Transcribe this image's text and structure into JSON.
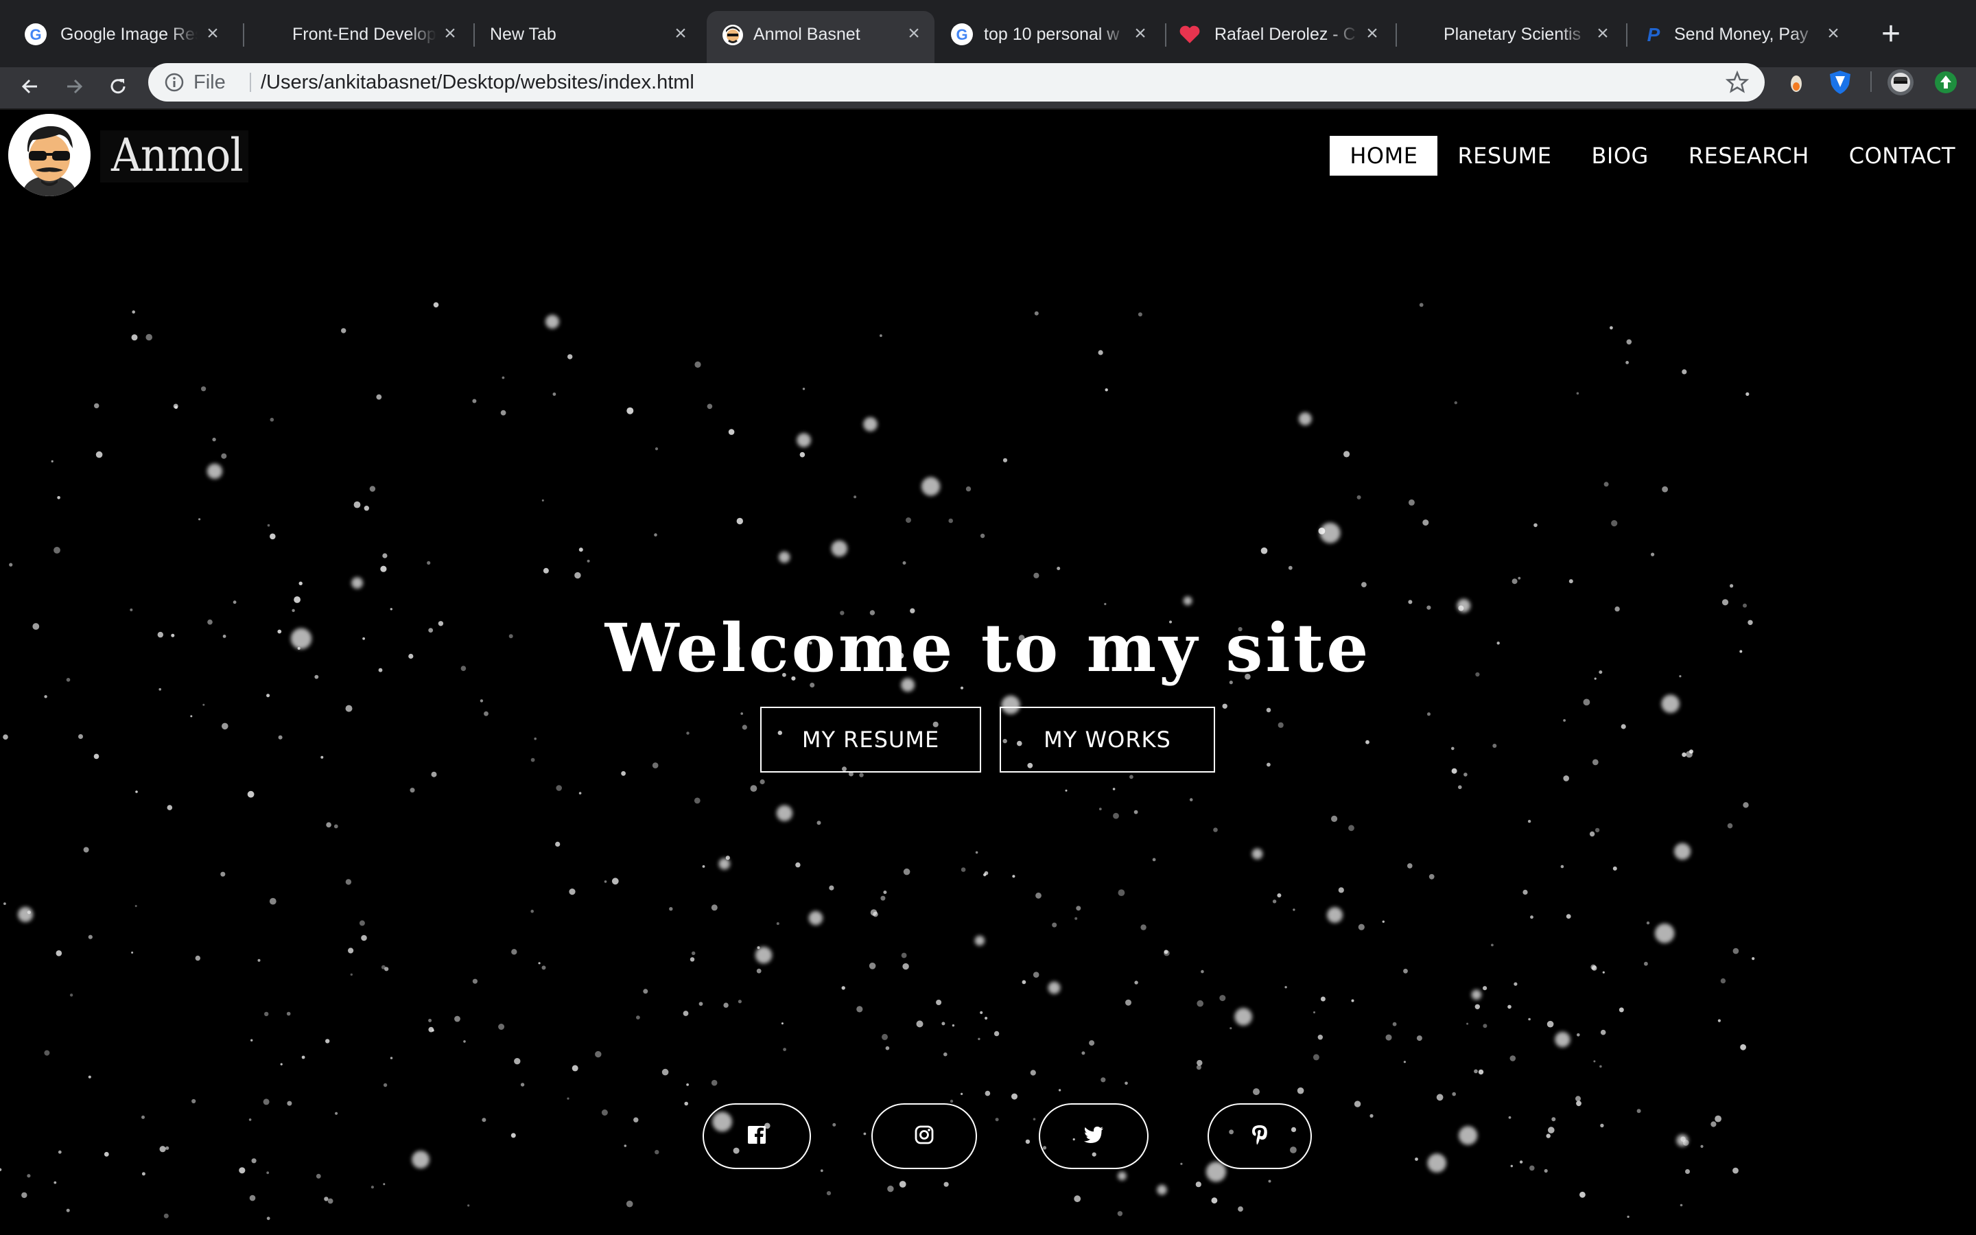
{
  "browser": {
    "tabs": [
      {
        "title": "Google Image Res",
        "favicon": "google-icon"
      },
      {
        "title": "Front-End Develop",
        "favicon": "none"
      },
      {
        "title": "New Tab",
        "favicon": "none"
      },
      {
        "title": "Anmol Basnet",
        "favicon": "avatar-icon",
        "active": true
      },
      {
        "title": "top 10 personal w",
        "favicon": "google-icon"
      },
      {
        "title": "Rafael Derolez - C",
        "favicon": "heart-icon"
      },
      {
        "title": "Planetary Scientis",
        "favicon": "none"
      },
      {
        "title": "Send Money, Pay",
        "favicon": "paypal-icon"
      }
    ],
    "close_glyph": "×",
    "new_tab_glyph": "+",
    "address": {
      "scheme": "File",
      "url": "/Users/ankitabasnet/Desktop/websites/index.html"
    },
    "accent": "#35363a"
  },
  "site": {
    "logo_text": "Anmol",
    "nav": [
      {
        "label": "HOME",
        "active": true
      },
      {
        "label": "RESUME"
      },
      {
        "label": "BIOG"
      },
      {
        "label": "RESEARCH"
      },
      {
        "label": "CONTACT"
      }
    ],
    "hero": {
      "title": "Welcome to my site",
      "buttons": [
        "MY RESUME",
        "MY WORKS"
      ]
    },
    "social": [
      "facebook-icon",
      "instagram-icon",
      "twitter-icon",
      "pinterest-icon"
    ]
  }
}
